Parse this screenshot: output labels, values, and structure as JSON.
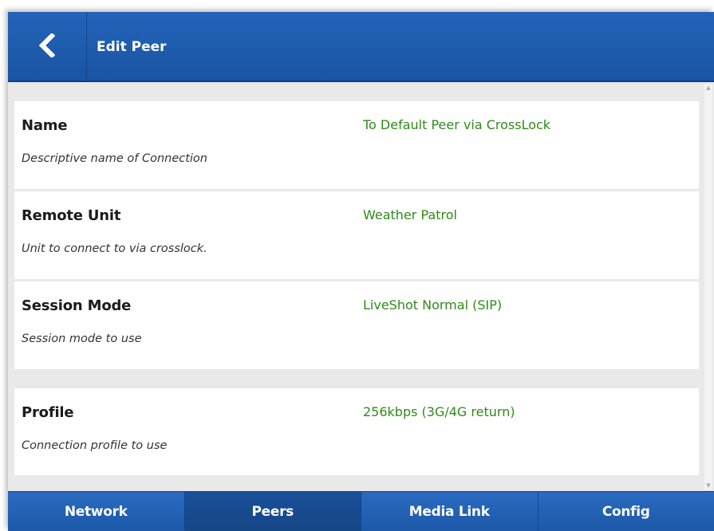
{
  "header": {
    "title": "Edit Peer",
    "back_icon": "chevron-left-icon"
  },
  "rows": [
    {
      "label": "Name",
      "description": "Descriptive name of Connection",
      "value": "To Default Peer via CrossLock"
    },
    {
      "label": "Remote Unit",
      "description": "Unit to connect to via crosslock.",
      "value": "Weather Patrol"
    },
    {
      "label": "Session Mode",
      "description": "Session mode to use",
      "value": "LiveShot Normal (SIP)"
    },
    {
      "label": "Profile",
      "description": "Connection profile to use",
      "value": "256kbps (3G/4G return)"
    }
  ],
  "tabs": [
    {
      "label": "Network",
      "active": false
    },
    {
      "label": "Peers",
      "active": true
    },
    {
      "label": "Media Link",
      "active": false
    },
    {
      "label": "Config",
      "active": false
    }
  ],
  "colors": {
    "header_blue": "#1f5cae",
    "value_green": "#2f8a1a",
    "content_bg": "#e9e9e9"
  }
}
